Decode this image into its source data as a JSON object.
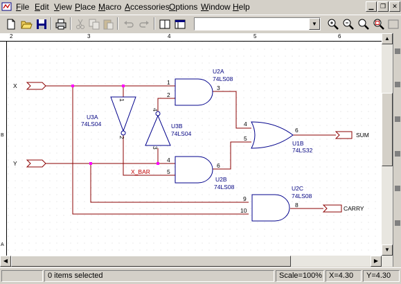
{
  "menubar": {
    "items": [
      "File",
      "Edit",
      "View",
      "Place",
      "Macro",
      "Accessories",
      "Options",
      "Window",
      "Help"
    ]
  },
  "ruler": {
    "marks": [
      "2",
      "3",
      "4",
      "5",
      "6"
    ],
    "left_marks": [
      "B",
      "A"
    ]
  },
  "schematic": {
    "ports": {
      "x": "X",
      "y": "Y",
      "sum": "SUM",
      "carry": "CARRY"
    },
    "net_label": "X_BAR",
    "parts": {
      "u2a": {
        "ref": "U2A",
        "value": "74LS08",
        "pins": [
          "1",
          "2",
          "3"
        ]
      },
      "u2b": {
        "ref": "U2B",
        "value": "74LS08",
        "pins": [
          "4",
          "5",
          "6"
        ]
      },
      "u1b": {
        "ref": "U1B",
        "value": "74LS32",
        "pins": [
          "4",
          "5",
          "6"
        ]
      },
      "u2c": {
        "ref": "U2C",
        "value": "74LS08",
        "pins": [
          "9",
          "10",
          "8"
        ]
      },
      "u3a": {
        "ref": "U3A",
        "value": "74LS04",
        "pins": [
          "1",
          "2"
        ]
      },
      "u3b": {
        "ref": "U3B",
        "value": "74LS04",
        "pins": [
          "4",
          "3"
        ]
      }
    },
    "colors": {
      "wire": "#8b0000",
      "part": "#00008b",
      "junction": "#ff00ff",
      "text": "#000080"
    }
  },
  "status": {
    "selection": "0 items selected",
    "scale": "Scale=100%",
    "x": "X=4.30",
    "y": "Y=4.30"
  }
}
